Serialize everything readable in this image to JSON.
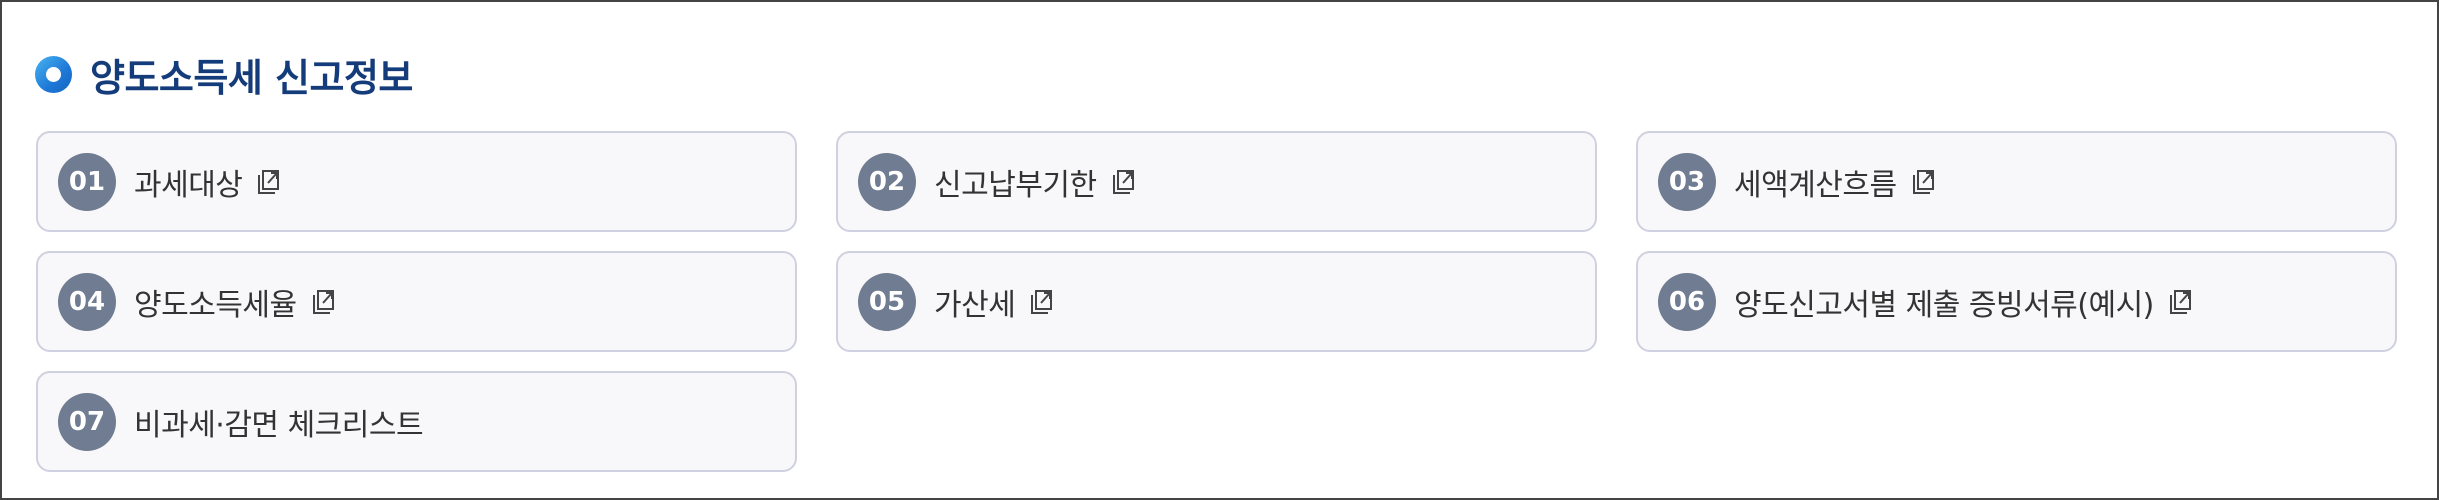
{
  "section": {
    "title": "양도소득세 신고정보"
  },
  "items": [
    {
      "num": "01",
      "label": "과세대상",
      "external": true
    },
    {
      "num": "02",
      "label": "신고납부기한",
      "external": true
    },
    {
      "num": "03",
      "label": "세액계산흐름",
      "external": true
    },
    {
      "num": "04",
      "label": "양도소득세율",
      "external": true
    },
    {
      "num": "05",
      "label": "가산세",
      "external": true
    },
    {
      "num": "06",
      "label": "양도신고서별 제출 증빙서류(예시)",
      "external": true
    },
    {
      "num": "07",
      "label": "비과세·감면 체크리스트",
      "external": false
    }
  ],
  "colors": {
    "title": "#143b7a",
    "badge": "#707c91",
    "card_bg": "#f8f8fa",
    "card_border": "#cfd1e0",
    "accent": "#1e78d6"
  },
  "icons": {
    "header": "circle-bullet-icon",
    "link": "external-link-icon"
  }
}
